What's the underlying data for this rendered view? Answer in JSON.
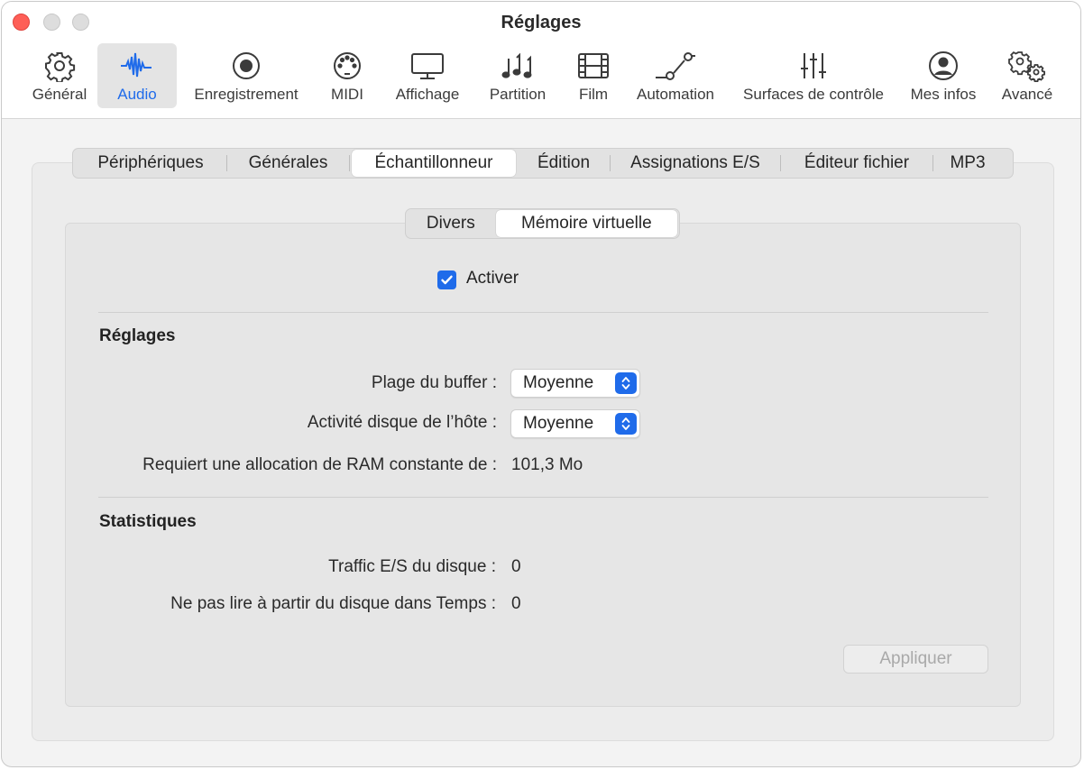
{
  "window": {
    "title": "Réglages"
  },
  "toolbar": {
    "items": [
      {
        "label": "Général",
        "icon": "gear-icon"
      },
      {
        "label": "Audio",
        "icon": "waveform-icon"
      },
      {
        "label": "Enregistrement",
        "icon": "record-icon"
      },
      {
        "label": "MIDI",
        "icon": "midi-port-icon"
      },
      {
        "label": "Affichage",
        "icon": "display-icon"
      },
      {
        "label": "Partition",
        "icon": "music-notes-icon"
      },
      {
        "label": "Film",
        "icon": "film-icon"
      },
      {
        "label": "Automation",
        "icon": "automation-curve-icon"
      },
      {
        "label": "Surfaces de contrôle",
        "icon": "faders-icon"
      },
      {
        "label": "Mes infos",
        "icon": "user-icon"
      },
      {
        "label": "Avancé",
        "icon": "gears-icon"
      }
    ],
    "selected": "Audio",
    "accent": "#1f6bea"
  },
  "tabs": {
    "items": [
      "Périphériques",
      "Générales",
      "Échantillonneur",
      "Édition",
      "Assignations E/S",
      "Éditeur fichier",
      "MP3"
    ],
    "selected": "Échantillonneur"
  },
  "subtabs": {
    "items": [
      "Divers",
      "Mémoire virtuelle"
    ],
    "selected": "Mémoire virtuelle"
  },
  "enable": {
    "label": "Activer",
    "checked": true
  },
  "settings": {
    "title": "Réglages",
    "buffer_label": "Plage du buffer :",
    "buffer_value": "Moyenne",
    "host_label": "Activité disque de l’hôte :",
    "host_value": "Moyenne",
    "ram_label": "Requiert une allocation de RAM constante de :",
    "ram_value": "101,3 Mo"
  },
  "stats": {
    "title": "Statistiques",
    "traffic_label": "Traffic E/S du disque :",
    "traffic_value": "0",
    "noread_label": "Ne pas lire à partir du disque dans Temps :",
    "noread_value": "0"
  },
  "apply_label": "Appliquer"
}
